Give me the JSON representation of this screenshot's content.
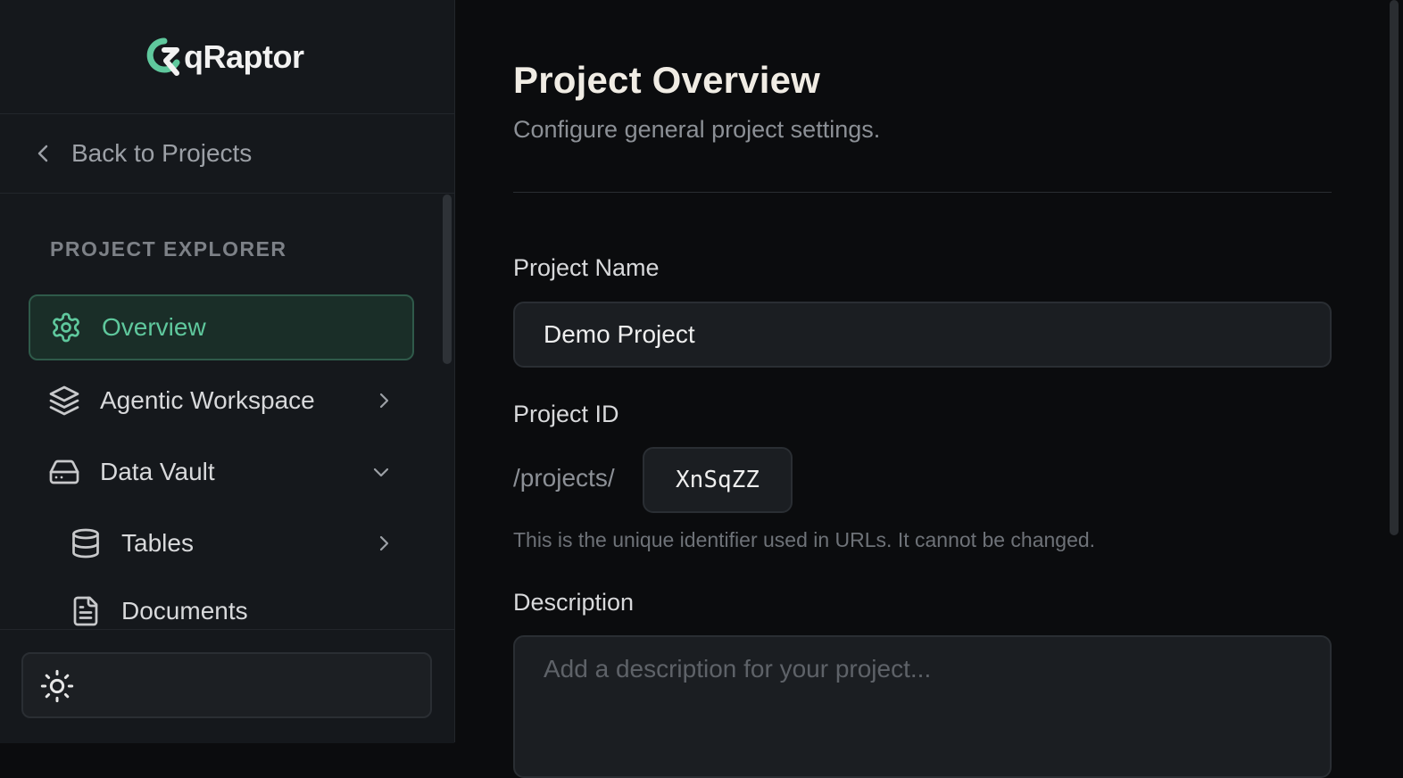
{
  "brand": {
    "name": "qRaptor",
    "accent": "#5fc89d"
  },
  "sidebar": {
    "back_label": "Back to Projects",
    "section_title": "PROJECT EXPLORER",
    "items": [
      {
        "label": "Overview",
        "icon": "gear-icon",
        "active": true
      },
      {
        "label": "Agentic Workspace",
        "icon": "layers-icon",
        "chevron": "right"
      },
      {
        "label": "Data Vault",
        "icon": "hard-drive-icon",
        "chevron": "down"
      },
      {
        "label": "Tables",
        "icon": "database-icon",
        "chevron": "right"
      },
      {
        "label": "Documents",
        "icon": "file-text-icon"
      }
    ],
    "theme_icon": "sun-icon"
  },
  "main": {
    "title": "Project Overview",
    "subtitle": "Configure general project settings.",
    "project_name_label": "Project Name",
    "project_name_value": "Demo Project",
    "project_id_label": "Project ID",
    "project_id_prefix": "/projects/",
    "project_id_value": "XnSqZZ",
    "project_id_help": "This is the unique identifier used in URLs. It cannot be changed.",
    "description_label": "Description",
    "description_placeholder": "Add a description for your project..."
  }
}
